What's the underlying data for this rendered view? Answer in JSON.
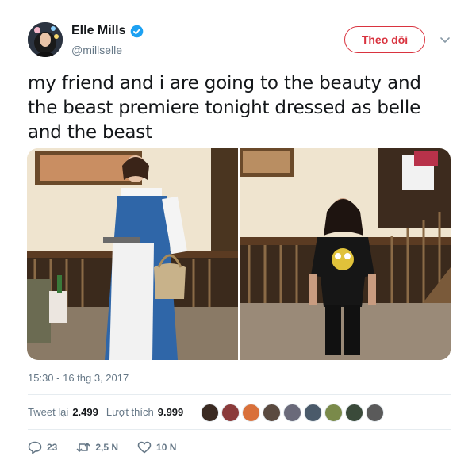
{
  "user": {
    "display_name": "Elle Mills",
    "handle": "@millselle",
    "verified_icon": "verified-badge-icon"
  },
  "header": {
    "follow_label": "Theo dõi",
    "more_icon": "chevron-down-icon"
  },
  "tweet": {
    "text": "my friend and i are going to the beauty and the beast premiere tonight dressed as belle and the beast",
    "timestamp": "15:30 - 16 thg 3, 2017"
  },
  "media": {
    "photo_count": 2,
    "photos": [
      "belle-costume-photo",
      "beast-tshirt-photo"
    ]
  },
  "stats": {
    "retweets_label": "Tweet lại",
    "retweets_value": "2.499",
    "likes_label": "Lượt thích",
    "likes_value": "9.999",
    "liker_avatar_count": 9
  },
  "actions": {
    "replies": "23",
    "retweets": "2,5 N",
    "likes": "10 N"
  },
  "colors": {
    "follow_red": "#d9333f",
    "verified_blue": "#1da1f2",
    "muted_gray": "#657786",
    "text_dark": "#14171a"
  }
}
